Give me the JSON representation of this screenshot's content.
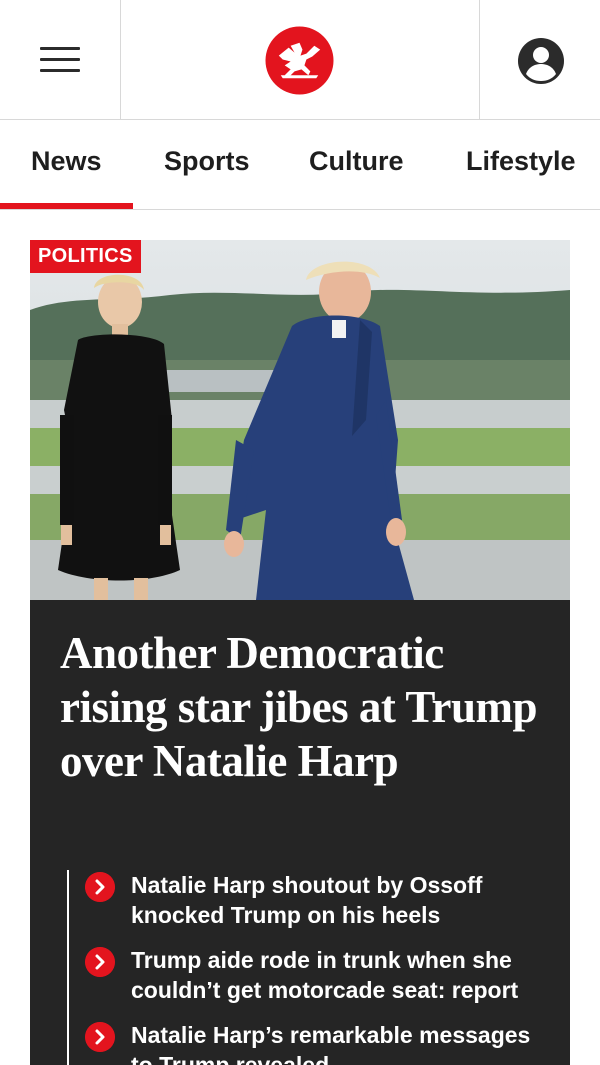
{
  "header": {
    "menu_icon": "hamburger-menu-icon",
    "logo_icon": "eagle-logo-icon",
    "account_icon": "user-account-icon",
    "brand_color": "#e3141e"
  },
  "nav": {
    "tabs": [
      {
        "label": "News",
        "active": true
      },
      {
        "label": "Sports",
        "active": false
      },
      {
        "label": "Culture",
        "active": false
      },
      {
        "label": "Lifestyle",
        "active": false
      }
    ]
  },
  "lead_story": {
    "section_badge": "POLITICS",
    "headline": "Another Democratic rising star jibes at Trump over Natalie Harp",
    "related": [
      {
        "title": "Natalie Harp shoutout by Ossoff knocked Trump on his heels"
      },
      {
        "title": "Trump aide rode in trunk when she couldn’t get motorcade seat: report"
      },
      {
        "title": "Natalie Harp’s remarkable messages to Trump revealed"
      }
    ]
  }
}
